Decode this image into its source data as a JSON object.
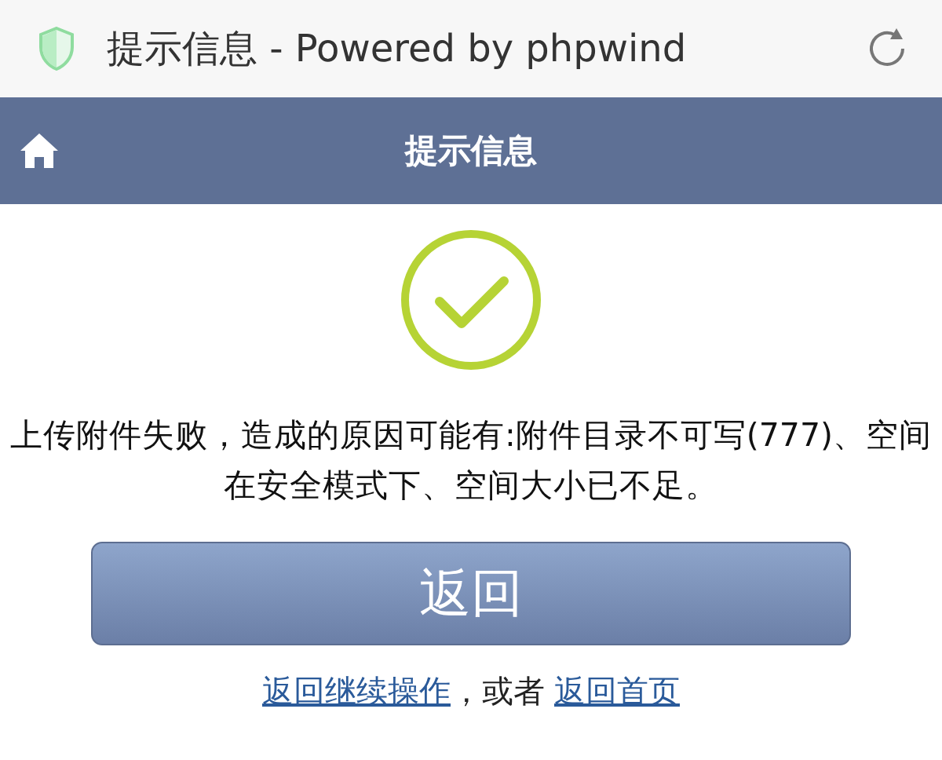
{
  "browser_bar": {
    "title": "提示信息 - Powered by phpwind"
  },
  "nav_bar": {
    "title": "提示信息"
  },
  "message": "上传附件失败，造成的原因可能有:附件目录不可写(777)、空间在安全模式下、空间大小已不足。",
  "button": "返回",
  "footer": {
    "link_1": "返回继续操作",
    "separator": "，或者",
    "link_2": "返回首页"
  }
}
